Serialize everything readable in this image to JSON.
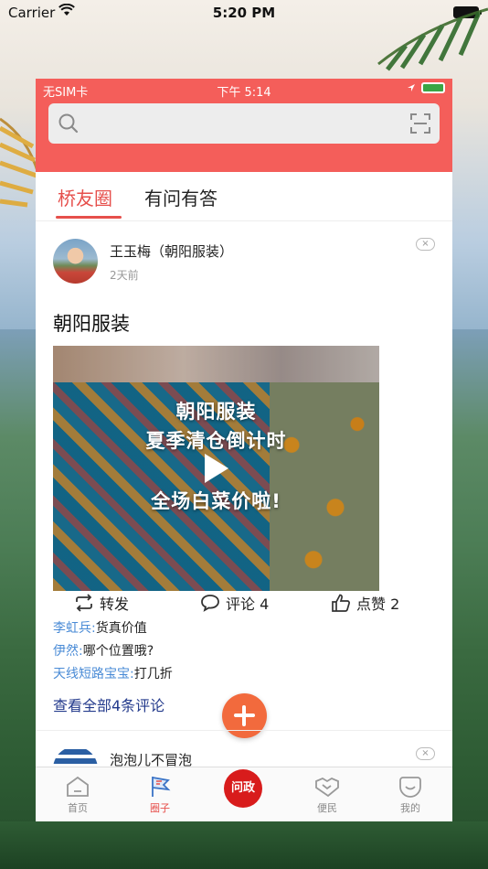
{
  "outer_status": {
    "carrier": "Carrier",
    "time": "5:20 PM"
  },
  "inner_status": {
    "carrier": "无SIM卡",
    "time": "下午 5:14"
  },
  "search": {
    "placeholder": ""
  },
  "tabs": [
    {
      "label": "桥友圈",
      "active": true
    },
    {
      "label": "有问有答",
      "active": false
    }
  ],
  "post": {
    "author": "王玉梅（朝阳服装）",
    "time_ago": "2天前",
    "close": "×",
    "title": "朝阳服装",
    "video_captions": [
      "朝阳服装",
      "夏季清仓倒计时",
      "全场白菜价啦!"
    ],
    "actions": {
      "share": "转发",
      "comment": "评论 4",
      "like": "点赞 2"
    },
    "comments": [
      {
        "name": "李虹兵:",
        "text": "货真价值"
      },
      {
        "name": "伊然:",
        "text": "哪个位置哦?"
      },
      {
        "name": "天线短路宝宝:",
        "text": "打几折"
      }
    ],
    "view_all": "查看全部4条评论"
  },
  "post2": {
    "author": "泡泡儿不冒泡",
    "close": "×"
  },
  "tabbar": [
    {
      "label": "首页",
      "icon": "home-icon"
    },
    {
      "label": "圈子",
      "icon": "flag-icon",
      "active": true
    },
    {
      "label": "问政",
      "icon": "ask-gov-logo"
    },
    {
      "label": "便民",
      "icon": "handshake-icon"
    },
    {
      "label": "我的",
      "icon": "smile-icon"
    }
  ],
  "colors": {
    "brand_red": "#f45e5a",
    "active_tab": "#e64f4b",
    "fab_orange": "#f26a3d",
    "comment_name": "#4a8bd6",
    "link_blue": "#233a8c"
  }
}
